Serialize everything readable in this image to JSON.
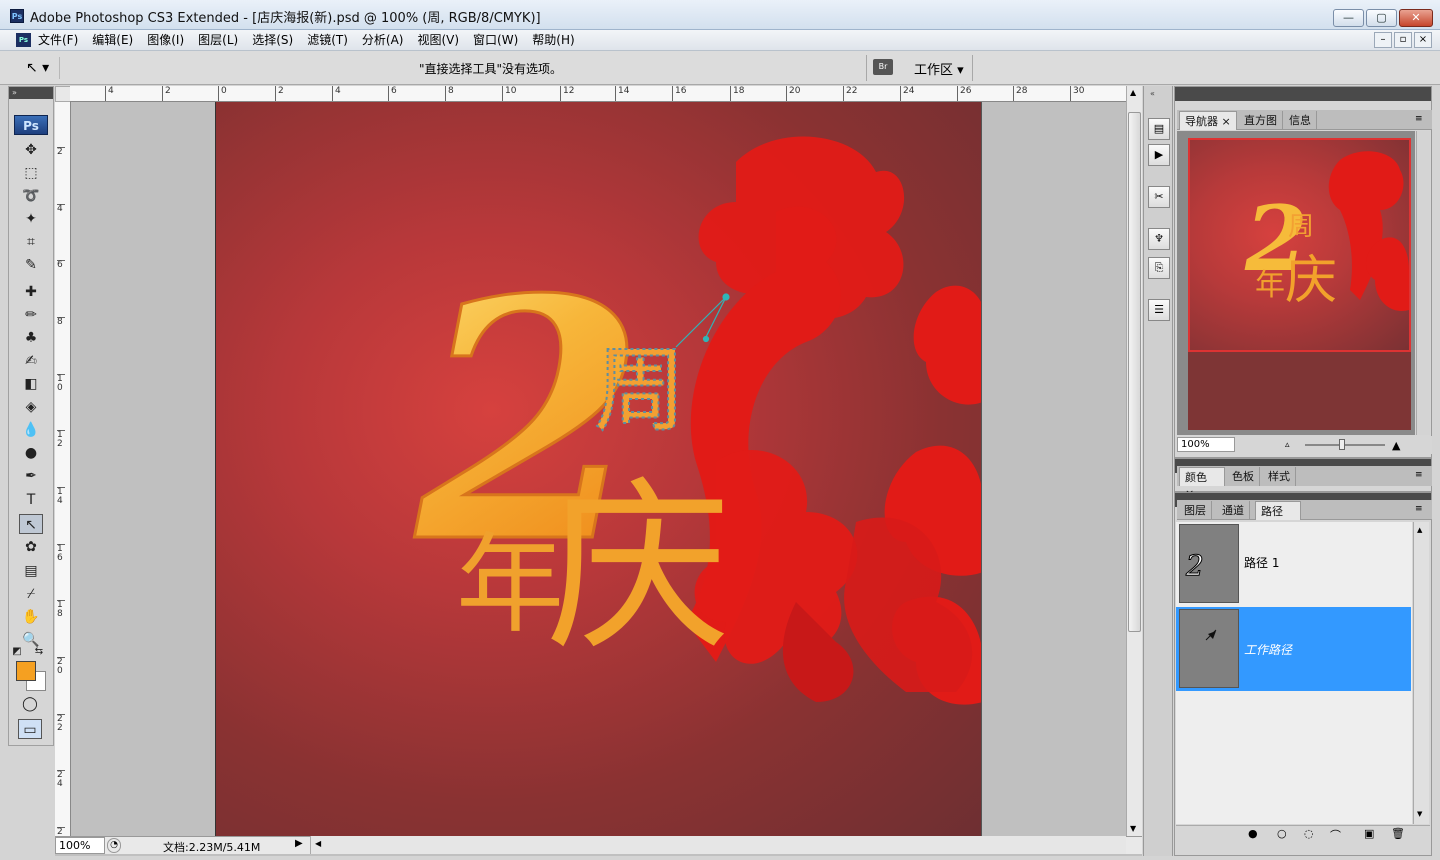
{
  "window": {
    "title": "Adobe Photoshop CS3 Extended - [店庆海报(新).psd @ 100% (周, RGB/8/CMYK)]",
    "app_icon": "Ps",
    "controls": {
      "minimize": "—",
      "maximize": "▢",
      "close": "✕"
    }
  },
  "menu": {
    "doc_icon": "Ps",
    "items": [
      "文件(F)",
      "编辑(E)",
      "图像(I)",
      "图层(L)",
      "选择(S)",
      "滤镜(T)",
      "分析(A)",
      "视图(V)",
      "窗口(W)",
      "帮助(H)"
    ]
  },
  "options": {
    "tool_glyph": "↖ ▾",
    "message": "\"直接选择工具\"没有选项。",
    "bridge_label": "Br",
    "workspace_label": "工作区 ▾"
  },
  "toolbar": {
    "header": "»",
    "logo": "Ps",
    "tools": [
      {
        "name": "move-tool",
        "glyph": "✥"
      },
      {
        "name": "marquee-tool",
        "glyph": "⬚"
      },
      {
        "name": "lasso-tool",
        "glyph": "➰"
      },
      {
        "name": "magic-wand-tool",
        "glyph": "✦"
      },
      {
        "name": "crop-tool",
        "glyph": "⌗"
      },
      {
        "name": "slice-tool",
        "glyph": "✎"
      },
      {
        "name": "healing-brush-tool",
        "glyph": "✚"
      },
      {
        "name": "brush-tool",
        "glyph": "✏"
      },
      {
        "name": "clone-stamp-tool",
        "glyph": "♣"
      },
      {
        "name": "history-brush-tool",
        "glyph": "✍"
      },
      {
        "name": "eraser-tool",
        "glyph": "◧"
      },
      {
        "name": "paint-bucket-tool",
        "glyph": "◈"
      },
      {
        "name": "blur-tool",
        "glyph": "💧"
      },
      {
        "name": "dodge-tool",
        "glyph": "●"
      },
      {
        "name": "pen-tool",
        "glyph": "✒"
      },
      {
        "name": "type-tool",
        "glyph": "T"
      },
      {
        "name": "direct-selection-tool",
        "glyph": "↖"
      },
      {
        "name": "custom-shape-tool",
        "glyph": "✿"
      },
      {
        "name": "notes-tool",
        "glyph": "▤"
      },
      {
        "name": "eyedropper-tool",
        "glyph": "⌿"
      },
      {
        "name": "hand-tool",
        "glyph": "✋"
      },
      {
        "name": "zoom-tool",
        "glyph": "🔍"
      }
    ],
    "fg_color": "#f5a021",
    "bg_color": "#ffffff",
    "quickmask_glyph": "◯",
    "screenmode_glyph": "▭"
  },
  "rulers": {
    "top": [
      "4",
      "2",
      "0",
      "2",
      "4",
      "6",
      "8",
      "10",
      "12",
      "14",
      "16",
      "18",
      "20",
      "22",
      "24",
      "26",
      "28",
      "30"
    ],
    "left": [
      "2",
      "4",
      "6",
      "8",
      "10",
      "12",
      "14",
      "16",
      "18",
      "20",
      "22",
      "24",
      "2"
    ]
  },
  "artwork": {
    "big_numeral": "2",
    "char_zhou": "周",
    "char_nian": "年",
    "char_qing": "庆"
  },
  "status": {
    "zoom": "100%",
    "docinfo": "文档:2.23M/5.41M",
    "arrow": "▶"
  },
  "navigator": {
    "tabs": [
      "导航器",
      "直方图",
      "信息"
    ],
    "zoom": "100%"
  },
  "color_panel": {
    "tabs": [
      "颜色",
      "色板",
      "样式"
    ]
  },
  "paths_panel": {
    "tabs": [
      "图层",
      "通道",
      "路径"
    ],
    "paths": [
      {
        "name": "路径 1",
        "selected": false
      },
      {
        "name": "工作路径",
        "selected": true
      }
    ]
  },
  "colors": {
    "selection_blue": "#3399ff",
    "cloud_red": "#e11b17",
    "gold": "#f5a021"
  }
}
